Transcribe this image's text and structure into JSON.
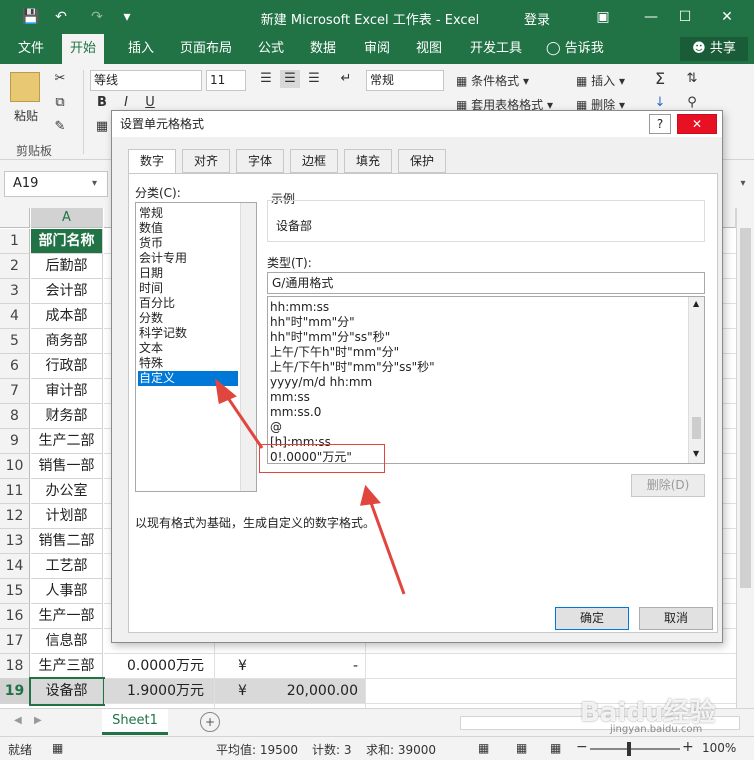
{
  "window": {
    "title": "新建 Microsoft Excel 工作表 - Excel",
    "login": "登录"
  },
  "ribbon_tabs": [
    "文件",
    "开始",
    "插入",
    "页面布局",
    "公式",
    "数据",
    "审阅",
    "视图",
    "开发工具"
  ],
  "tell_me": "告诉我",
  "share": "共享",
  "ribbon": {
    "paste": "粘贴",
    "clipboard_group": "剪贴板",
    "font_name": "等线",
    "font_size": "11",
    "bold": "B",
    "italic": "I",
    "underline": "U",
    "number_format": "常规",
    "conditional_format": "条件格式",
    "table_format": "套用表格格式",
    "insert": "插入",
    "delete": "删除"
  },
  "namebox": "A19",
  "column_headers": [
    "A"
  ],
  "rows": [
    {
      "n": "1",
      "a": "部门名称",
      "head": true
    },
    {
      "n": "2",
      "a": "后勤部"
    },
    {
      "n": "3",
      "a": "会计部"
    },
    {
      "n": "4",
      "a": "成本部"
    },
    {
      "n": "5",
      "a": "商务部"
    },
    {
      "n": "6",
      "a": "行政部"
    },
    {
      "n": "7",
      "a": "审计部"
    },
    {
      "n": "8",
      "a": "财务部"
    },
    {
      "n": "9",
      "a": "生产二部"
    },
    {
      "n": "10",
      "a": "销售一部"
    },
    {
      "n": "11",
      "a": "办公室"
    },
    {
      "n": "12",
      "a": "计划部"
    },
    {
      "n": "13",
      "a": "销售二部"
    },
    {
      "n": "14",
      "a": "工艺部"
    },
    {
      "n": "15",
      "a": "人事部"
    },
    {
      "n": "16",
      "a": "生产一部"
    },
    {
      "n": "17",
      "a": "信息部"
    },
    {
      "n": "18",
      "a": "生产三部",
      "b": "0.0000万元",
      "c": "¥",
      "d": "-"
    },
    {
      "n": "19",
      "a": "设备部",
      "b": "1.9000万元",
      "c": "¥",
      "d": "20,000.00",
      "selected": true
    }
  ],
  "sheet_tab": "Sheet1",
  "status": {
    "ready": "就绪",
    "average": "平均值: 19500",
    "count": "计数: 3",
    "sum": "求和: 39000",
    "zoom": "100%"
  },
  "dialog": {
    "title": "设置单元格格式",
    "help": "?",
    "tabs": [
      "数字",
      "对齐",
      "字体",
      "边框",
      "填充",
      "保护"
    ],
    "category_label": "分类(C):",
    "categories": [
      "常规",
      "数值",
      "货币",
      "会计专用",
      "日期",
      "时间",
      "百分比",
      "分数",
      "科学记数",
      "文本",
      "特殊",
      "自定义"
    ],
    "sample_label": "示例",
    "sample_value": "设备部",
    "type_label": "类型(T):",
    "type_value": "G/通用格式",
    "type_list": [
      "hh:mm:ss",
      "hh\"时\"mm\"分\"",
      "hh\"时\"mm\"分\"ss\"秒\"",
      "上午/下午h\"时\"mm\"分\"",
      "上午/下午h\"时\"mm\"分\"ss\"秒\"",
      "yyyy/m/d hh:mm",
      "mm:ss",
      "mm:ss.0",
      "@",
      "[h]:mm:ss",
      "0!.0000\"万元\""
    ],
    "delete_btn": "删除(D)",
    "description": "以现有格式为基础，生成自定义的数字格式。",
    "ok": "确定",
    "cancel": "取消"
  },
  "watermark": "Baidu经验",
  "watermark_url": "jingyan.baidu.com",
  "colors": {
    "excel_green": "#217346",
    "selection_blue": "#0078d7",
    "annotation_red": "#e0463e"
  }
}
